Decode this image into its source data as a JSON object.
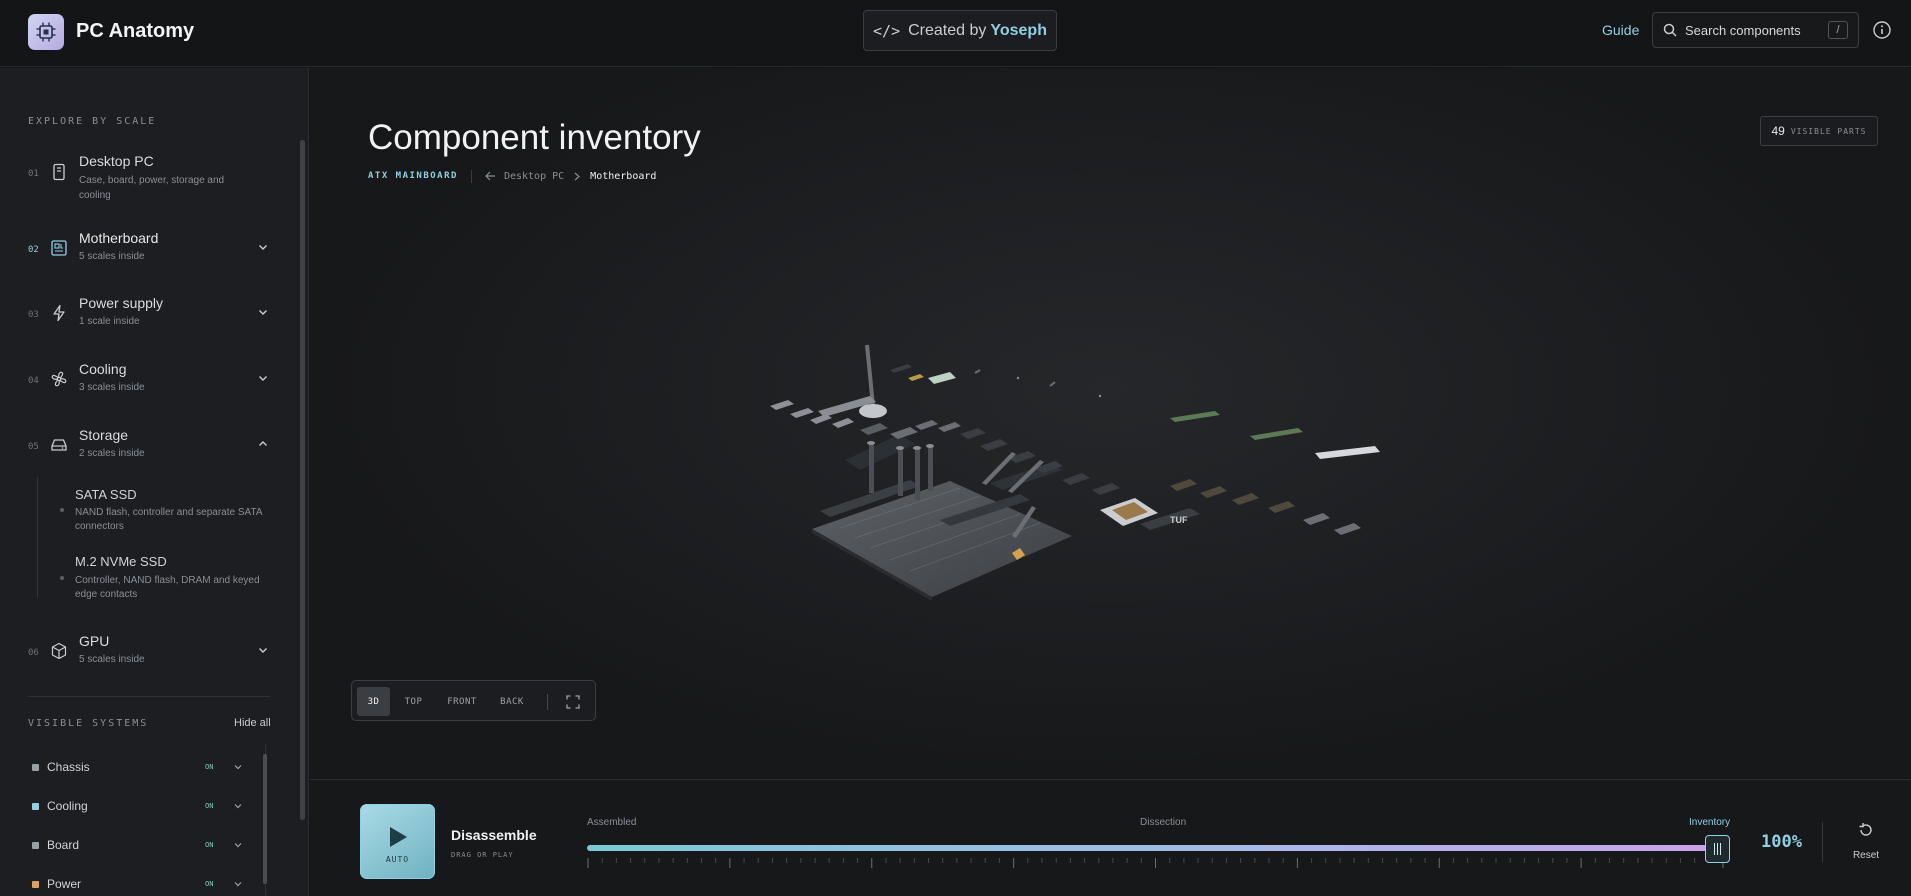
{
  "header": {
    "app_title": "PC Anatomy",
    "credit_prefix": "Created by",
    "credit_name": "Yoseph",
    "guide_label": "Guide",
    "search_placeholder": "Search components",
    "search_shortcut": "/"
  },
  "sidebar": {
    "explore_label": "EXPLORE BY SCALE",
    "scales": [
      {
        "num": "01",
        "title": "Desktop PC",
        "sub": "Case, board, power, storage and cooling",
        "icon": "tower-icon"
      },
      {
        "num": "02",
        "title": "Motherboard",
        "sub": "5 scales inside",
        "icon": "board-icon",
        "active": true
      },
      {
        "num": "03",
        "title": "Power supply",
        "sub": "1 scale inside",
        "icon": "bolt-icon"
      },
      {
        "num": "04",
        "title": "Cooling",
        "sub": "3 scales inside",
        "icon": "fan-icon"
      },
      {
        "num": "05",
        "title": "Storage",
        "sub": "2 scales inside",
        "icon": "drive-icon",
        "expanded": true
      },
      {
        "num": "06",
        "title": "GPU",
        "sub": "5 scales inside",
        "icon": "cube-icon"
      }
    ],
    "storage_children": [
      {
        "title": "SATA SSD",
        "desc": "NAND flash, controller and separate SATA connectors"
      },
      {
        "title": "M.2 NVMe SSD",
        "desc": "Controller, NAND flash, DRAM and keyed edge contacts"
      }
    ],
    "systems_label": "VISIBLE SYSTEMS",
    "hide_all_label": "Hide all",
    "systems": [
      {
        "name": "Chassis",
        "state": "ON",
        "color": "#9aa0a8"
      },
      {
        "name": "Cooling",
        "state": "ON",
        "color": "#8fd0e2"
      },
      {
        "name": "Board",
        "state": "ON",
        "color": "#9aa0a8"
      },
      {
        "name": "Power",
        "state": "ON",
        "color": "#e0a15a"
      }
    ]
  },
  "main": {
    "title": "Component inventory",
    "tag": "ATX MAINBOARD",
    "crumb_prev": "Desktop PC",
    "crumb_current": "Motherboard",
    "visible_parts_count": "49",
    "visible_parts_label": "VISIBLE PARTS",
    "views": [
      "3D",
      "TOP",
      "FRONT",
      "BACK"
    ],
    "active_view": "3D",
    "model_label": "TUF"
  },
  "bottom": {
    "auto_label": "AUTO",
    "action_title": "Disassemble",
    "action_sub": "DRAG OR PLAY",
    "stage_labels": [
      "Assembled",
      "Dissection",
      "Inventory"
    ],
    "progress_percent": 100,
    "progress_text": "100%",
    "reset_label": "Reset"
  },
  "colors": {
    "accent": "#8fd0e2",
    "background": "#141517",
    "sidebar": "#1c1e21"
  }
}
